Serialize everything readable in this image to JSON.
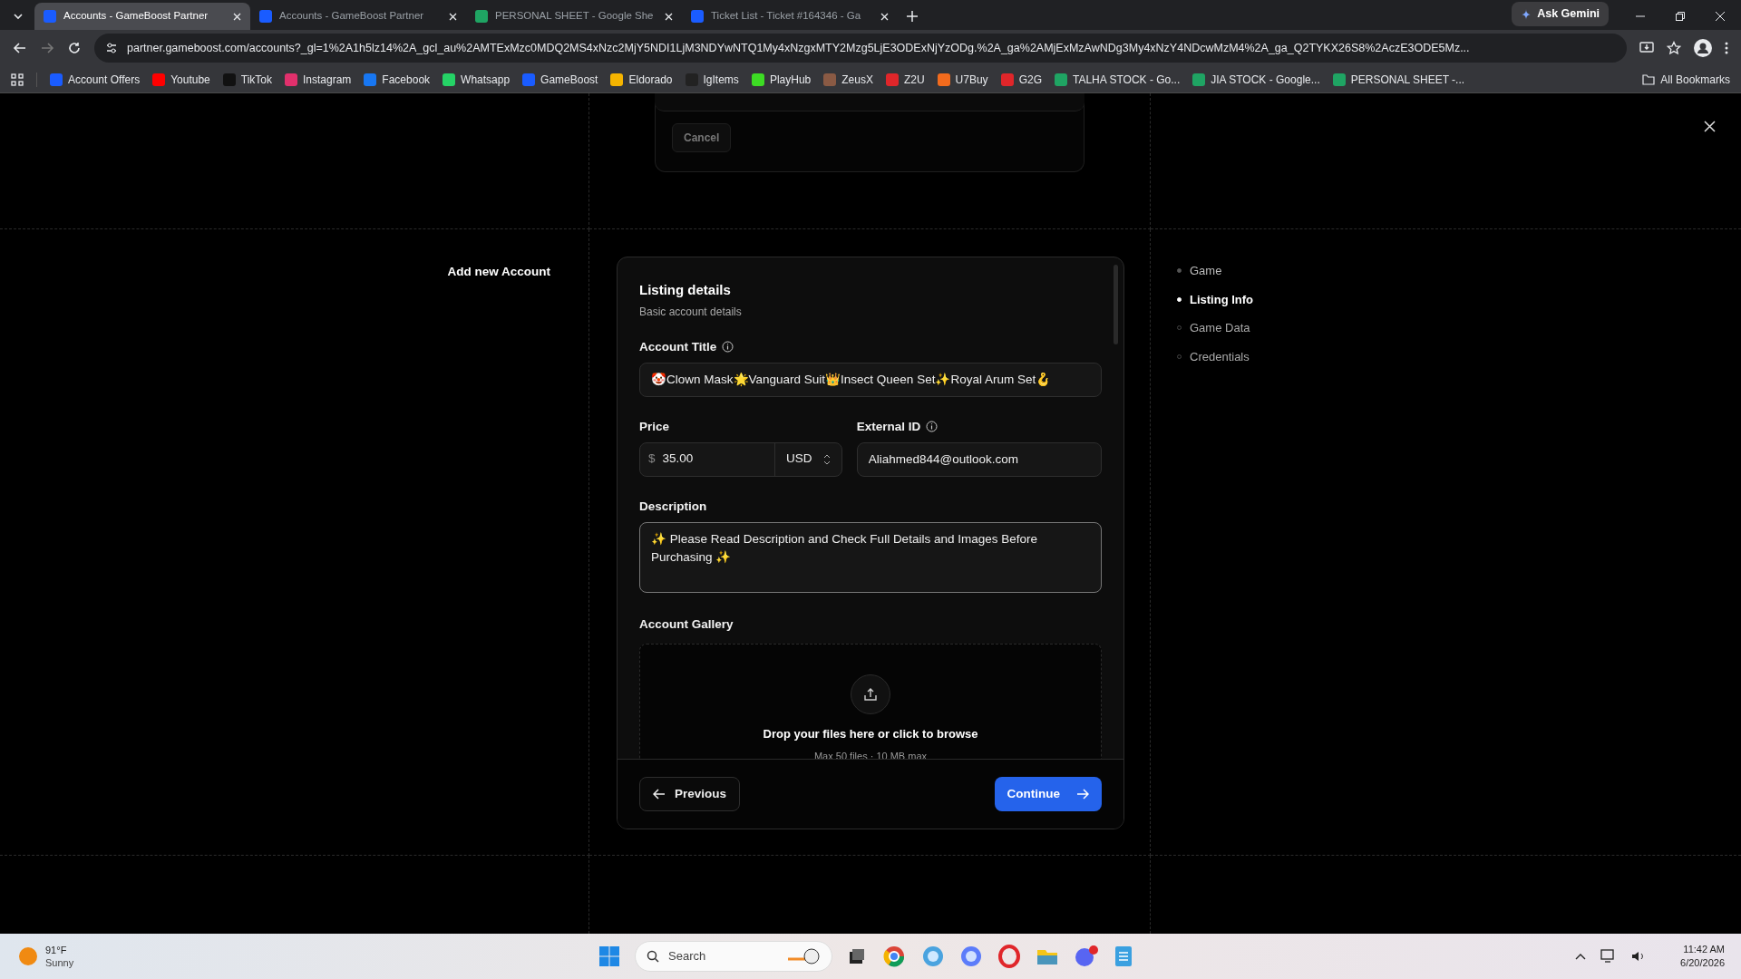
{
  "browser": {
    "tabs": [
      {
        "title": "Accounts - GameBoost Partner",
        "selected": true,
        "color": "#1a5cff"
      },
      {
        "title": "Accounts - GameBoost Partner",
        "selected": false,
        "color": "#1a5cff"
      },
      {
        "title": "PERSONAL SHEET - Google She",
        "selected": false,
        "color": "#1fa463"
      },
      {
        "title": "Ticket List - Ticket #164346 - Ga",
        "selected": false,
        "color": "#1a5cff"
      }
    ],
    "ask_gemini": "Ask Gemini",
    "url": "partner.gameboost.com/accounts?_gl=1%2A1h5lz14%2A_gcl_au%2AMTExMzc0MDQ2MS4xNzc2MjY5NDI1LjM3NDYwNTQ1My4xNzgxMTY2Mzg5LjE3ODExNjYzODg.%2A_ga%2AMjExMzAwNDg3My4xNzY4NDcwMzM4%2A_ga_Q2TYKX26S8%2AczE3ODE5Mz...",
    "bookmarks": [
      {
        "label": "Account Offers",
        "color": "#1a5cff"
      },
      {
        "label": "Youtube",
        "color": "#ff0000"
      },
      {
        "label": "TikTok",
        "color": "#111111"
      },
      {
        "label": "Instagram",
        "color": "#e1306c"
      },
      {
        "label": "Facebook",
        "color": "#1877f2"
      },
      {
        "label": "Whatsapp",
        "color": "#25d366"
      },
      {
        "label": "GameBoost",
        "color": "#1a5cff"
      },
      {
        "label": "Eldorado",
        "color": "#f5b400"
      },
      {
        "label": "IgItems",
        "color": "#222222"
      },
      {
        "label": "PlayHub",
        "color": "#3ddc24"
      },
      {
        "label": "ZeusX",
        "color": "#8a5a44"
      },
      {
        "label": "Z2U",
        "color": "#e0262a"
      },
      {
        "label": "U7Buy",
        "color": "#f26b1d"
      },
      {
        "label": "G2G",
        "color": "#e0262a"
      },
      {
        "label": "TALHA STOCK - Go...",
        "color": "#1fa463"
      },
      {
        "label": "JIA STOCK - Google...",
        "color": "#1fa463"
      },
      {
        "label": "PERSONAL SHEET -...",
        "color": "#1fa463"
      }
    ],
    "all_bookmarks": "All Bookmarks"
  },
  "page": {
    "cancel": "Cancel",
    "heading": "Add new Account",
    "steps": [
      {
        "label": "Game",
        "completed": true,
        "selected": false
      },
      {
        "label": "Listing Info",
        "completed": false,
        "selected": true
      },
      {
        "label": "Game Data",
        "completed": false,
        "selected": false
      },
      {
        "label": "Credentials",
        "completed": false,
        "selected": false
      }
    ],
    "form": {
      "title": "Listing details",
      "subtitle": "Basic account details",
      "account_title": {
        "label": "Account Title",
        "value": "🤡Clown Mask🌟Vanguard Suit👑Insect Queen Set✨Royal Arum Set🪝"
      },
      "price": {
        "label": "Price",
        "symbol": "$",
        "value": "35.00",
        "currency": "USD"
      },
      "external_id": {
        "label": "External ID",
        "value": "Aliahmed844@outlook.com"
      },
      "description": {
        "label": "Description",
        "value": "✨ Please Read Description and Check Full Details and Images Before Purchasing ✨"
      },
      "gallery": {
        "label": "Account Gallery",
        "prompt": "Drop your files here or click to browse",
        "hint": "Max 50 files · 10 MB max"
      },
      "previous": "Previous",
      "continue": "Continue"
    }
  },
  "taskbar": {
    "temperature": "91°F",
    "condition": "Sunny",
    "search_placeholder": "Search",
    "time": "11:42 AM",
    "date": "6/20/2026"
  }
}
